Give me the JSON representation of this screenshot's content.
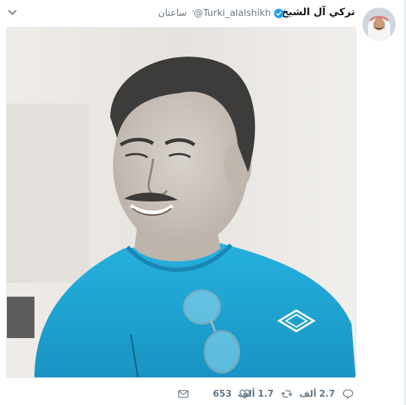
{
  "tweet": {
    "display_name": "تركي آل الشيخ",
    "handle": "@Turki_alalshikh",
    "separator": "·",
    "timestamp": "ساعتان",
    "verified": true,
    "media_alt_subject": "photo"
  },
  "actions": {
    "reply": {
      "count": "2.7",
      "unit": "ألف"
    },
    "retweet": {
      "count": "1.7",
      "unit": "ألف"
    },
    "like": {
      "count": "653"
    },
    "dm": {}
  },
  "colors": {
    "text_primary": "#14171a",
    "text_secondary": "#657786",
    "verified_blue": "#1da1f2",
    "shirt_cyan": "#1fa6d4"
  },
  "icons": [
    "chevron-down-icon",
    "verified-badge-icon",
    "reply-icon",
    "retweet-icon",
    "heart-icon",
    "envelope-icon"
  ]
}
